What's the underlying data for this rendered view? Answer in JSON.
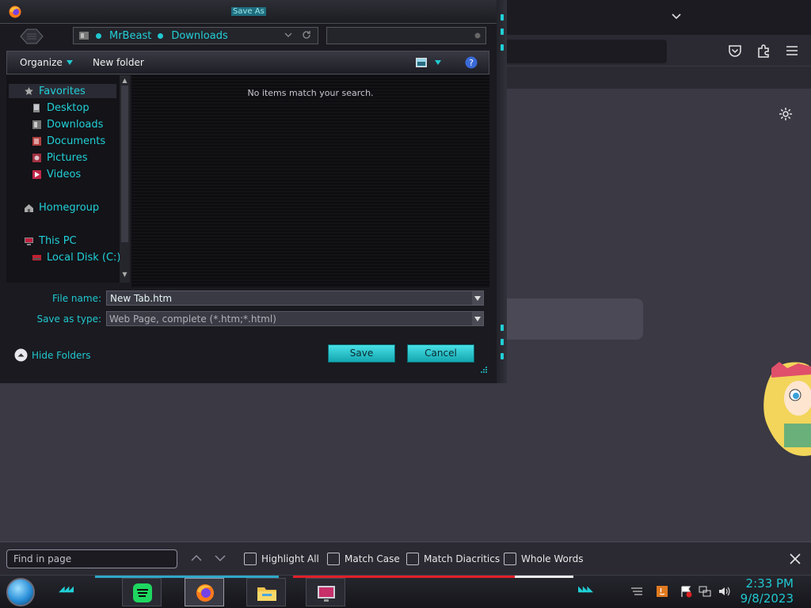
{
  "dialog": {
    "title": "Save As",
    "breadcrumb": [
      "MrBeast",
      "Downloads"
    ],
    "search_placeholder": "",
    "toolbar": {
      "organize": "Organize",
      "new_folder": "New folder"
    },
    "nav": {
      "favorites": "Favorites",
      "favorites_items": [
        "Desktop",
        "Downloads",
        "Documents",
        "Pictures",
        "Videos"
      ],
      "homegroup": "Homegroup",
      "this_pc": "This PC",
      "this_pc_items": [
        "Local Disk (C:)"
      ]
    },
    "empty_message": "No items match your search.",
    "file_name_label": "File name:",
    "file_name_value": "New Tab.htm",
    "save_type_label": "Save as type:",
    "save_type_value": "Web Page, complete (*.htm;*.html)",
    "hide_folders": "Hide Folders",
    "save_button": "Save",
    "cancel_button": "Cancel"
  },
  "findbar": {
    "placeholder": "Find in page",
    "highlight_all": "Highlight All",
    "match_case": "Match Case",
    "match_diacritics": "Match Diacritics",
    "whole_words": "Whole Words"
  },
  "taskbar": {
    "time": "2:33 PM",
    "date": "9/8/2023"
  },
  "colors": {
    "accent": "#20d0d6",
    "button": "#2cc4cc",
    "taskbar_red": "#e0202a"
  }
}
